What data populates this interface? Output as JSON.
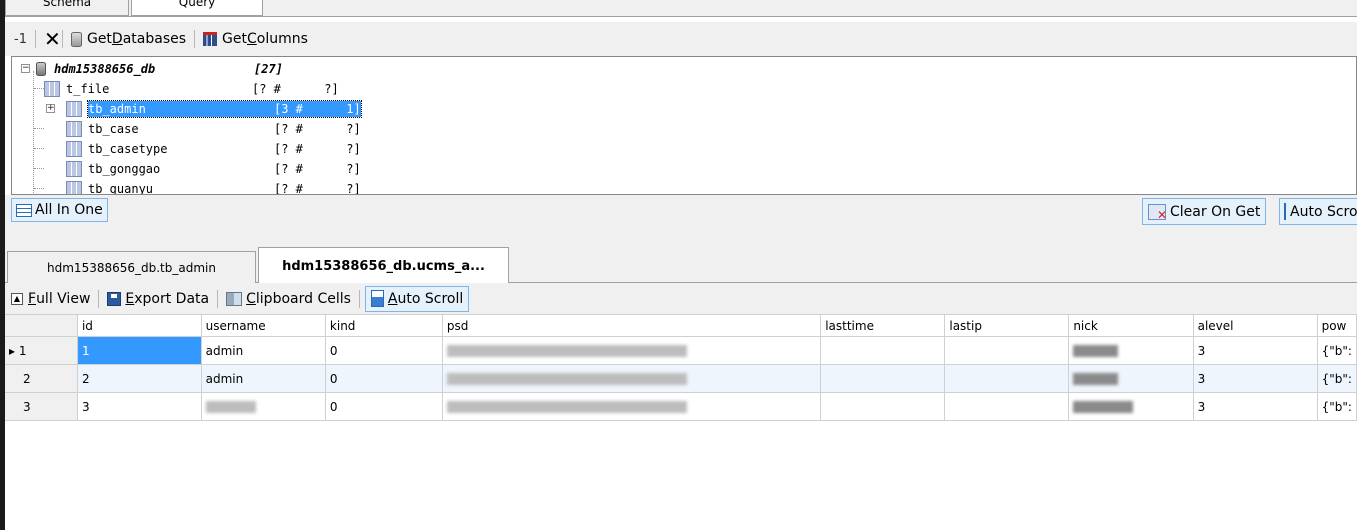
{
  "top_tabs": {
    "schema": "Schema",
    "query": "Query"
  },
  "toolbar1": {
    "counter": "-1",
    "get_databases": [
      "Get ",
      "D",
      "atabases"
    ],
    "get_columns": [
      "Get ",
      "C",
      "olumns"
    ]
  },
  "tree": {
    "root": {
      "name": "hdm15388656_db",
      "count": "[27]"
    },
    "items": [
      {
        "name": "t_file",
        "info": "[? #      ?]"
      },
      {
        "name": "tb_admin",
        "info": "[3 #      1]"
      },
      {
        "name": "tb_case",
        "info": "[? #      ?]"
      },
      {
        "name": "tb_casetype",
        "info": "[? #      ?]"
      },
      {
        "name": "tb_gonggao",
        "info": "[? #      ?]"
      },
      {
        "name": "tb_guanyu",
        "info": "[? #      ?]"
      }
    ]
  },
  "bar": {
    "all_in_one": "All In One",
    "clear_on_get": "Clear On Get",
    "auto_scroll": "Auto Scroll"
  },
  "result_tabs": {
    "tab1": "hdm15388656_db.tb_admin",
    "tab2": "hdm15388656_db.ucms_a..."
  },
  "toolbar2": {
    "full_view": [
      "F",
      "ull View"
    ],
    "export_data": [
      "E",
      "xport Data"
    ],
    "clipboard": [
      "C",
      "lipboard Cells"
    ],
    "auto_scroll": [
      "A",
      "uto Scroll"
    ]
  },
  "grid": {
    "columns": [
      "id",
      "username",
      "kind",
      "psd",
      "lasttime",
      "lastip",
      "nick",
      "alevel",
      "pow"
    ],
    "rows": [
      {
        "rh": "▸ 1",
        "id": "1",
        "username": "admin",
        "kind": "0",
        "alevel": "3",
        "pow": "{\"b\":"
      },
      {
        "rh": "2",
        "id": "2",
        "username": "admin",
        "kind": "0",
        "alevel": "3",
        "pow": "{\"b\":"
      },
      {
        "rh": "3",
        "id": "3",
        "username": "",
        "kind": "0",
        "alevel": "3",
        "pow": "{\"b\":"
      }
    ]
  }
}
